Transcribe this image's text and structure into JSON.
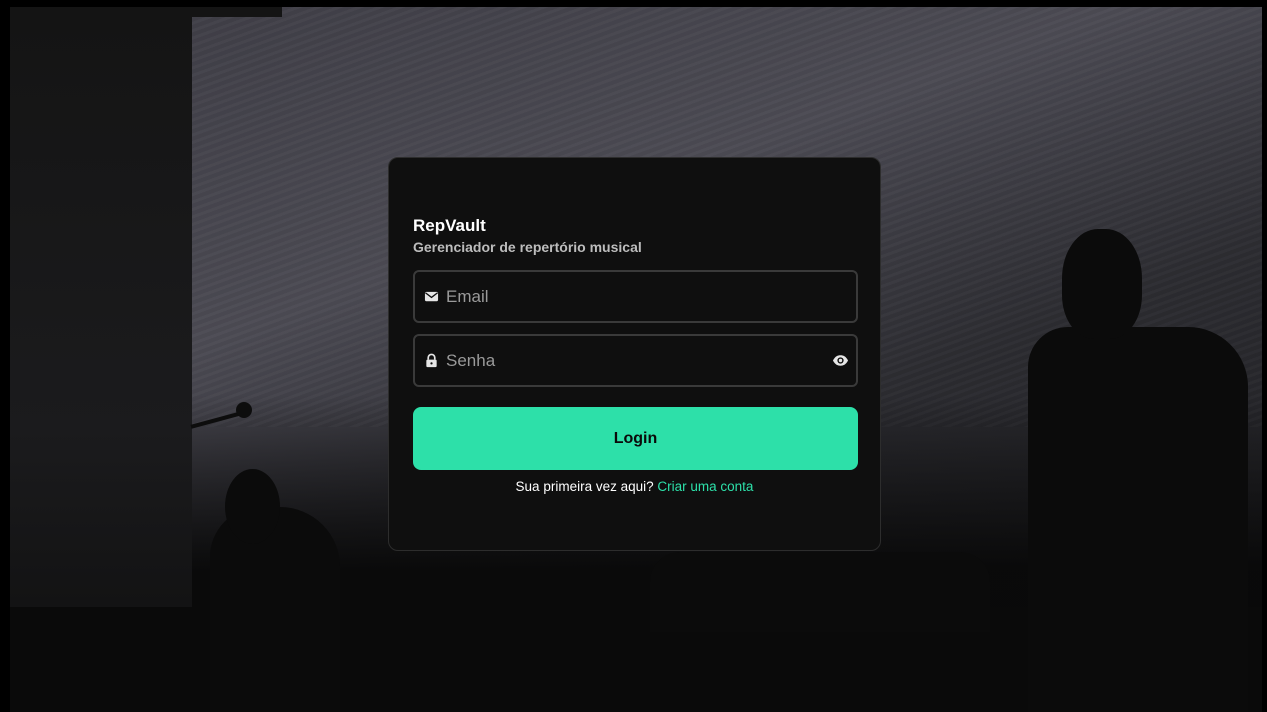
{
  "app": {
    "name": "RepVault",
    "subtitle": "Gerenciador de repertório musical"
  },
  "form": {
    "email": {
      "value": "",
      "placeholder": "Email",
      "icon": "envelope-icon"
    },
    "password": {
      "value": "",
      "placeholder": "Senha",
      "icon": "lock-icon",
      "toggle_icon": "eye-icon"
    },
    "submit_label": "Login"
  },
  "signup": {
    "prompt": "Sua primeira vez aqui?",
    "link_label": "Criar uma conta"
  },
  "colors": {
    "accent": "#2de0a9",
    "card_background": "#0f0f0f",
    "field_border": "#3a3a3a"
  }
}
